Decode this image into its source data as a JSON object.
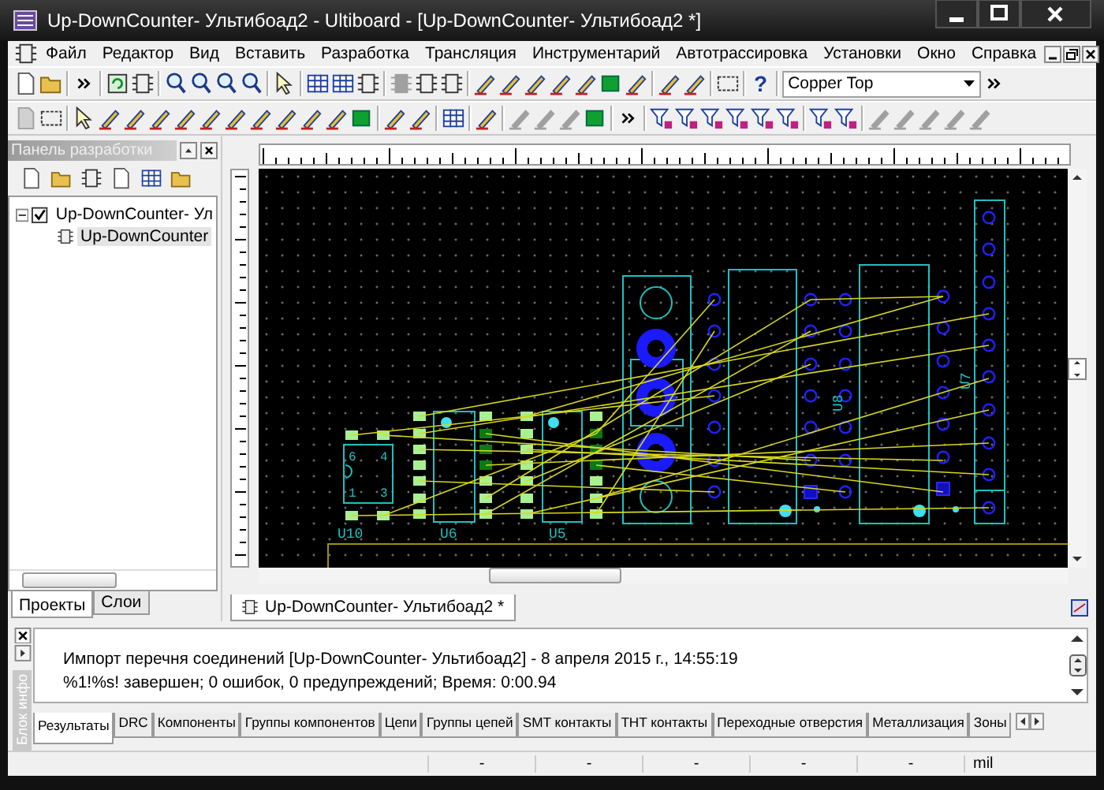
{
  "window": {
    "title": "Up-DownCounter- Ультибоад2 - Ultiboard - [Up-DownCounter- Ультибоад2 *]"
  },
  "menu": [
    {
      "label": "Файл"
    },
    {
      "label": "Редактор"
    },
    {
      "label": "Вид"
    },
    {
      "label": "Вставить"
    },
    {
      "label": "Разработка"
    },
    {
      "label": "Трансляция"
    },
    {
      "label": "Инструментарий"
    },
    {
      "label": "Автотрассировка"
    },
    {
      "label": "Установки"
    },
    {
      "label": "Окно"
    },
    {
      "label": "Справка"
    }
  ],
  "toolbar": {
    "help": "?",
    "layer_select": "Copper Top"
  },
  "design_panel": {
    "title": "Панель разработки",
    "tree": [
      {
        "label": "Up-DownCounter- Ул",
        "checked": true,
        "expanded": true,
        "selected": false,
        "children": [
          {
            "label": "Up-DownCounter",
            "selected": true
          }
        ]
      }
    ],
    "tabs": [
      {
        "label": "Проекты",
        "selected": true
      },
      {
        "label": "Слои",
        "selected": false
      }
    ]
  },
  "document": {
    "tab": "Up-DownCounter- Ультибоад2 *",
    "pcb": {
      "labels": [
        {
          "text": "U10"
        },
        {
          "text": "U6"
        },
        {
          "text": "U5"
        },
        {
          "text": "U8"
        },
        {
          "text": "U7"
        }
      ],
      "pin_numbers": [
        {
          "text": "6"
        },
        {
          "text": "4"
        },
        {
          "text": "1"
        },
        {
          "text": "3"
        }
      ]
    }
  },
  "output": {
    "side_tab": "Блок инфо",
    "lines": [
      "Импорт перечня соединений [Up-DownCounter- Ультибоад2]  - 8 апреля 2015 г., 14:55:19",
      "%1!%s! завершен;  0 ошибок, 0 предупреждений;  Время: 0:00.94"
    ],
    "tabs": [
      {
        "label": "Результаты",
        "selected": true
      },
      {
        "label": "DRC",
        "selected": false
      },
      {
        "label": "Компоненты",
        "selected": false
      },
      {
        "label": "Группы компонентов",
        "selected": false
      },
      {
        "label": "Цепи",
        "selected": false
      },
      {
        "label": "Группы цепей",
        "selected": false
      },
      {
        "label": "SMT контакты",
        "selected": false
      },
      {
        "label": "THT контакты",
        "selected": false
      },
      {
        "label": "Переходные отверстия",
        "selected": false
      },
      {
        "label": "Металлизация",
        "selected": false
      },
      {
        "label": "Зоны",
        "selected": false
      }
    ]
  },
  "status_bar": [
    "-",
    "-",
    "-",
    "-",
    "-",
    "mil"
  ]
}
